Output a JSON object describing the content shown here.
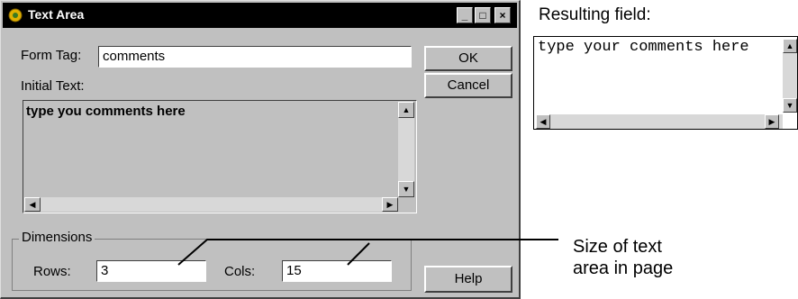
{
  "dialog": {
    "title": "Text Area",
    "controls": {
      "minimize": "_",
      "maximize": "□",
      "close": "×"
    },
    "form_tag": {
      "label": "Form Tag:",
      "value": "comments"
    },
    "initial_text": {
      "label": "Initial Text:",
      "value": "type you comments here"
    },
    "buttons": {
      "ok": "OK",
      "cancel": "Cancel",
      "help": "Help"
    },
    "dimensions": {
      "group_label": "Dimensions",
      "rows_label": "Rows:",
      "rows_value": "3",
      "cols_label": "Cols:",
      "cols_value": "15"
    }
  },
  "result": {
    "label": "Resulting field:",
    "text": "type your comments here"
  },
  "callout": {
    "line1": "Size of text",
    "line2": "area in page"
  }
}
